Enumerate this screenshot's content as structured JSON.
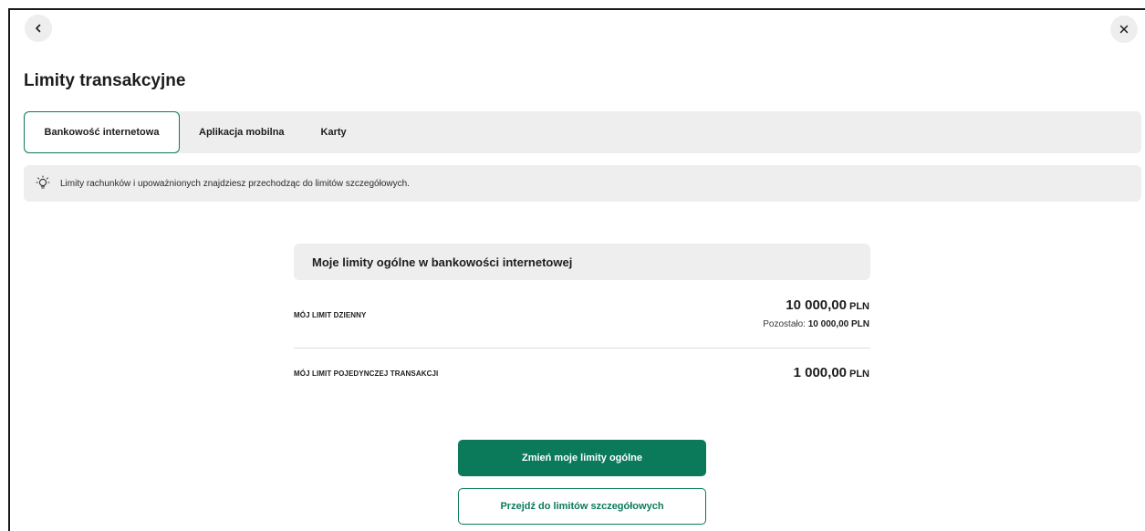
{
  "header": {
    "back_icon": "chevron-left-icon",
    "close_icon": "close-icon",
    "title": "Limity transakcyjne"
  },
  "tabs": [
    {
      "label": "Bankowość internetowa",
      "active": true
    },
    {
      "label": "Aplikacja mobilna",
      "active": false
    },
    {
      "label": "Karty",
      "active": false
    }
  ],
  "info": {
    "icon": "lightbulb-icon",
    "text": "Limity rachunków i upoważnionych znajdziesz przechodząc do limitów szczegółowych."
  },
  "limits": {
    "header": "Moje limity ogólne w bankowości internetowej",
    "daily": {
      "label": "MÓJ LIMIT DZIENNY",
      "amount": "10 000,00",
      "currency": "PLN",
      "remaining_label": "Pozostało:",
      "remaining_value": "10 000,00 PLN"
    },
    "single": {
      "label": "MÓJ LIMIT POJEDYNCZEJ TRANSAKCJI",
      "amount": "1 000,00",
      "currency": "PLN"
    }
  },
  "actions": {
    "change_label": "Zmień moje limity ogólne",
    "detailed_label": "Przejdź do limitów szczegółowych"
  },
  "colors": {
    "accent": "#0b7a5b",
    "panel": "#eeeeef"
  }
}
